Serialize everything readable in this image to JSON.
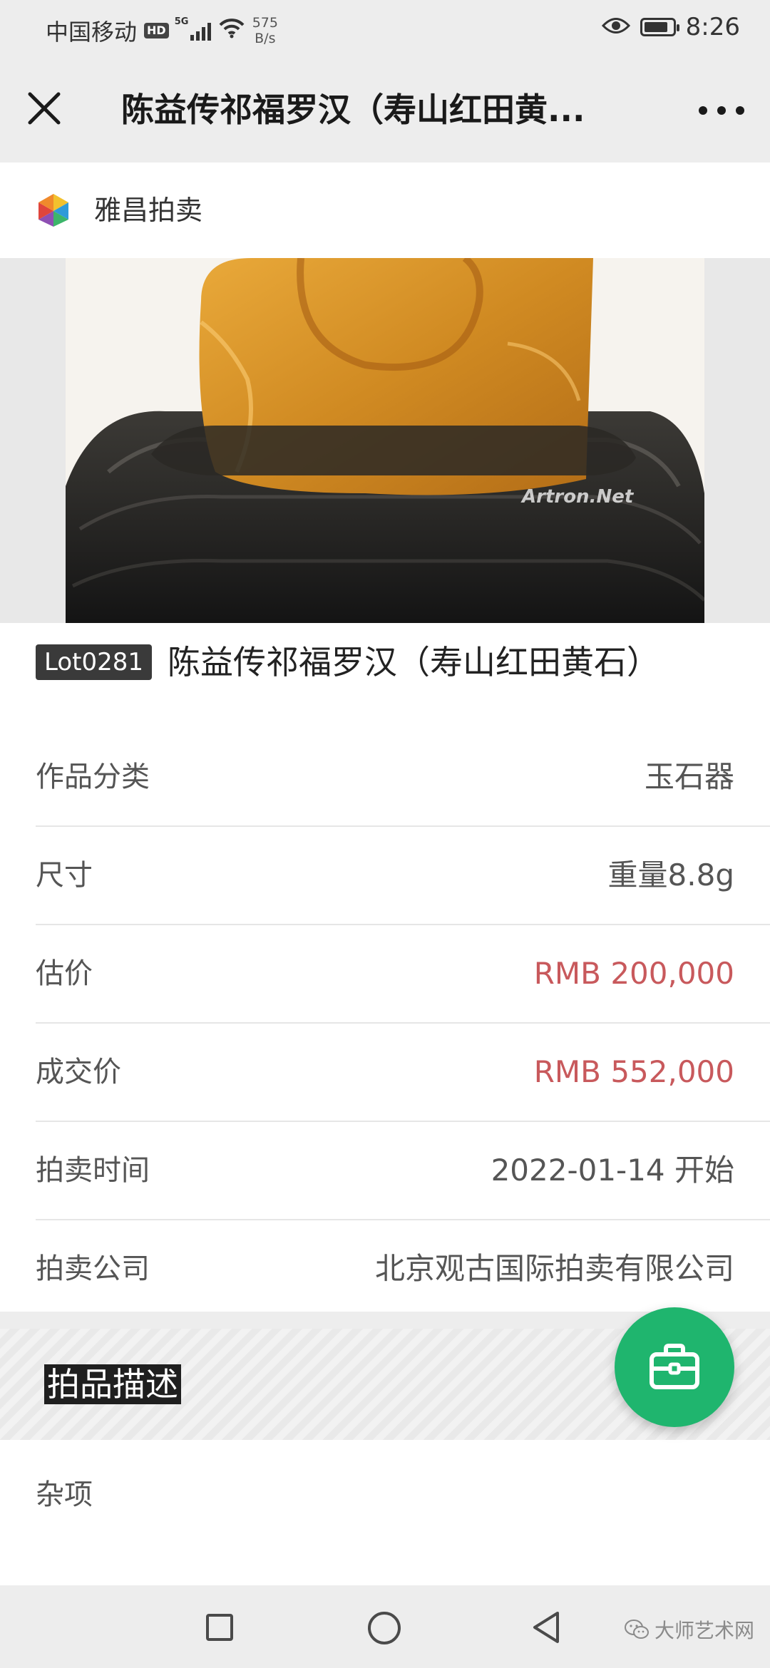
{
  "status_bar": {
    "carrier": "中国移动",
    "hd": "HD",
    "network": "5G",
    "speed_value": "575",
    "speed_unit": "B/s",
    "time": "8:26",
    "battery_level": 0.85
  },
  "title_bar": {
    "title": "陈益传祁福罗汉（寿山红田黄..."
  },
  "brand": {
    "name": "雅昌拍卖"
  },
  "hero": {
    "watermark": "Artron.Net"
  },
  "lot": {
    "badge": "Lot0281",
    "name": "陈益传祁福罗汉（寿山红田黄石）"
  },
  "details": [
    {
      "label": "作品分类",
      "value": "玉石器"
    },
    {
      "label": "尺寸",
      "value": "重量8.8g"
    },
    {
      "label": "估价",
      "value": "RMB 200,000"
    },
    {
      "label": "成交价",
      "value": "RMB 552,000"
    },
    {
      "label": "拍卖时间",
      "value": "2022-01-14 开始"
    },
    {
      "label": "拍卖公司",
      "value": "北京观古国际拍卖有限公司"
    }
  ],
  "description": {
    "title": "拍品描述",
    "category": "杂项"
  },
  "footer": {
    "brand": "大师艺术网"
  },
  "colors": {
    "price": "#c8595c",
    "fab": "#1fb56e",
    "bar_bg": "#ededed"
  }
}
